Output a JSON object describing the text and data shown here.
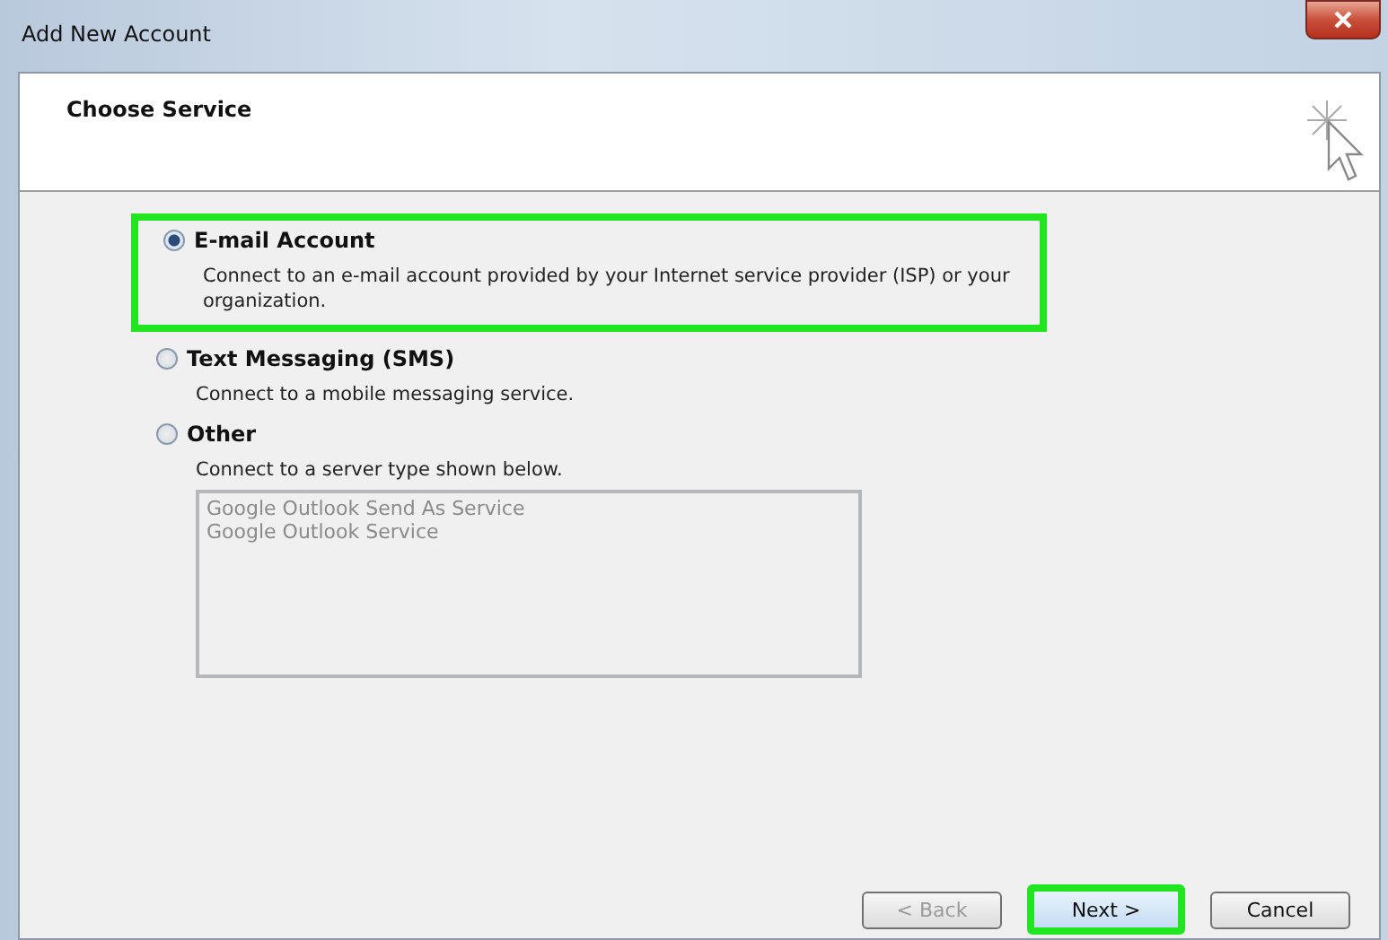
{
  "window": {
    "title": "Add New Account"
  },
  "header": {
    "title": "Choose Service"
  },
  "options": [
    {
      "label": "E-mail Account",
      "description": "Connect to an e-mail account provided by your Internet service provider (ISP) or your organization.",
      "selected": true,
      "highlighted": true
    },
    {
      "label": "Text Messaging (SMS)",
      "description": "Connect to a mobile messaging service.",
      "selected": false,
      "highlighted": false
    },
    {
      "label": "Other",
      "description": "Connect to a server type shown below.",
      "selected": false,
      "highlighted": false
    }
  ],
  "server_list": {
    "disabled": true,
    "items": [
      "Google Outlook Send As Service",
      "Google Outlook Service"
    ]
  },
  "buttons": [
    {
      "label": "< Back",
      "disabled": true,
      "highlighted": false
    },
    {
      "label": "Next >",
      "disabled": false,
      "highlighted": true
    },
    {
      "label": "Cancel",
      "disabled": false,
      "highlighted": false
    }
  ]
}
